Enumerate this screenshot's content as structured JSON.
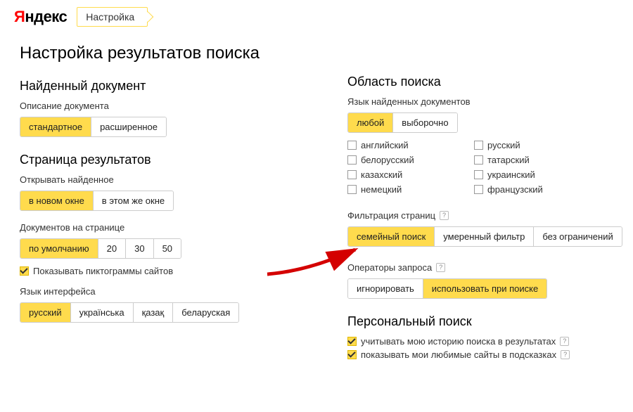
{
  "header": {
    "logo_accent": "Я",
    "logo_rest": "ндекс",
    "settings_label": "Настройка"
  },
  "page_title": "Настройка результатов поиска",
  "left": {
    "found_doc": {
      "title": "Найденный документ",
      "desc_label": "Описание документа",
      "options": [
        "стандартное",
        "расширенное"
      ],
      "active": 0
    },
    "results_page": {
      "title": "Страница результатов",
      "open_label": "Открывать найденное",
      "open_options": [
        "в новом окне",
        "в этом же окне"
      ],
      "open_active": 0,
      "docs_label": "Документов на странице",
      "docs_options": [
        "по умолчанию",
        "20",
        "30",
        "50"
      ],
      "docs_active": 0,
      "show_favicons": "Показывать пиктограммы сайтов",
      "iface_label": "Язык интерфейса",
      "iface_options": [
        "русский",
        "українська",
        "қазақ",
        "беларуская"
      ],
      "iface_active": 0
    }
  },
  "right": {
    "search_area": {
      "title": "Область поиска",
      "lang_label": "Язык найденных документов",
      "lang_mode": [
        "любой",
        "выборочно"
      ],
      "lang_mode_active": 0,
      "langs": [
        "английский",
        "русский",
        "белорусский",
        "татарский",
        "казахский",
        "украинский",
        "немецкий",
        "французский"
      ]
    },
    "filter": {
      "label": "Фильтрация страниц",
      "options": [
        "семейный поиск",
        "умеренный фильтр",
        "без ограничений"
      ],
      "active": 0
    },
    "operators": {
      "label": "Операторы запроса",
      "options": [
        "игнорировать",
        "использовать при поиске"
      ],
      "active": 1
    },
    "personal": {
      "title": "Персональный поиск",
      "opt1": "учитывать мою историю поиска в результатах",
      "opt2": "показывать мои любимые сайты в подсказках"
    }
  }
}
